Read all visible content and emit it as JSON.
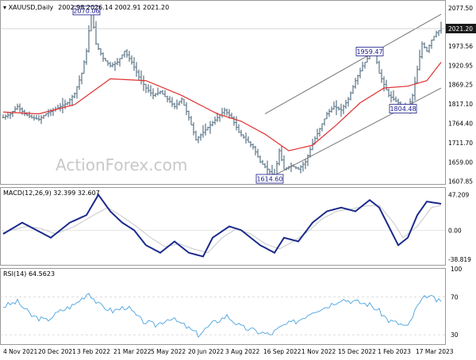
{
  "header": {
    "symbol": "XAUUSD,Daily",
    "ohlc": "2002.98 2026.14 2002.91 2021.20"
  },
  "watermark": "ActionForex.com",
  "colors": {
    "bar": "#5b7486",
    "ma": "#e03030",
    "channel": "#777777",
    "macd": "#1b2a8c",
    "signal": "#c8c8c8",
    "rsi": "#4aa3df",
    "price_badge": "#1a1a1a",
    "annotation_border": "#1a1a8c"
  },
  "chart_data": [
    {
      "type": "ohlc",
      "title": "XAUUSD,Daily",
      "ylim": [
        1600,
        2090
      ],
      "y_ticks": [
        "2077.50",
        "2021.20",
        "1973.56",
        "1920.95",
        "1869.25",
        "1817.10",
        "1764.40",
        "1711.70",
        "1659.00",
        "1607.85"
      ],
      "current_price": "2021.20",
      "x_ticks": [
        "4 Nov 2021",
        "20 Dec 2021",
        "3 Feb 2022",
        "21 Mar 2022",
        "5 May 2022",
        "20 Jun 2022",
        "3 Aug 2022",
        "16 Sep 2022",
        "1 Nov 2022",
        "15 Dec 2022",
        "1 Feb 2023",
        "17 Mar 2023"
      ],
      "price_path": [
        [
          0,
          1780
        ],
        [
          3,
          1790
        ],
        [
          6,
          1810
        ],
        [
          9,
          1790
        ],
        [
          12,
          1780
        ],
        [
          15,
          1775
        ],
        [
          18,
          1790
        ],
        [
          21,
          1800
        ],
        [
          24,
          1810
        ],
        [
          27,
          1820
        ],
        [
          30,
          1845
        ],
        [
          33,
          1900
        ],
        [
          35,
          1960
        ],
        [
          37,
          2070
        ],
        [
          39,
          1980
        ],
        [
          42,
          1940
        ],
        [
          45,
          1920
        ],
        [
          48,
          1930
        ],
        [
          51,
          1960
        ],
        [
          54,
          1930
        ],
        [
          57,
          1890
        ],
        [
          60,
          1860
        ],
        [
          63,
          1840
        ],
        [
          66,
          1850
        ],
        [
          69,
          1830
        ],
        [
          72,
          1810
        ],
        [
          75,
          1830
        ],
        [
          78,
          1780
        ],
        [
          81,
          1720
        ],
        [
          84,
          1740
        ],
        [
          87,
          1760
        ],
        [
          90,
          1780
        ],
        [
          93,
          1800
        ],
        [
          96,
          1780
        ],
        [
          99,
          1740
        ],
        [
          102,
          1720
        ],
        [
          105,
          1700
        ],
        [
          108,
          1660
        ],
        [
          111,
          1640
        ],
        [
          114,
          1620
        ],
        [
          116,
          1690
        ],
        [
          118,
          1640
        ],
        [
          121,
          1650
        ],
        [
          124,
          1640
        ],
        [
          127,
          1660
        ],
        [
          130,
          1710
        ],
        [
          133,
          1750
        ],
        [
          136,
          1790
        ],
        [
          139,
          1810
        ],
        [
          142,
          1800
        ],
        [
          145,
          1830
        ],
        [
          148,
          1880
        ],
        [
          151,
          1920
        ],
        [
          154,
          1950
        ],
        [
          156,
          1959
        ],
        [
          158,
          1900
        ],
        [
          160,
          1870
        ],
        [
          162,
          1840
        ],
        [
          164,
          1830
        ],
        [
          166,
          1820
        ],
        [
          168,
          1810
        ],
        [
          170,
          1804
        ],
        [
          172,
          1840
        ],
        [
          174,
          1910
        ],
        [
          176,
          1980
        ],
        [
          178,
          1960
        ],
        [
          180,
          1990
        ],
        [
          182,
          2010
        ],
        [
          184,
          2021
        ]
      ],
      "moving_average": [
        [
          0,
          1795
        ],
        [
          15,
          1790
        ],
        [
          30,
          1815
        ],
        [
          45,
          1885
        ],
        [
          60,
          1880
        ],
        [
          75,
          1840
        ],
        [
          90,
          1790
        ],
        [
          100,
          1770
        ],
        [
          110,
          1735
        ],
        [
          120,
          1690
        ],
        [
          130,
          1705
        ],
        [
          140,
          1760
        ],
        [
          150,
          1820
        ],
        [
          160,
          1860
        ],
        [
          170,
          1865
        ],
        [
          178,
          1880
        ],
        [
          184,
          1930
        ]
      ],
      "channel_lines": [
        [
          [
            110,
            1790
          ],
          [
            184,
            2060
          ]
        ],
        [
          [
            110,
            1610
          ],
          [
            184,
            1860
          ]
        ]
      ],
      "annotations": [
        {
          "label": "2070.06",
          "x": 37,
          "y": 2070
        },
        {
          "label": "1959.47",
          "x": 156,
          "y": 1959
        },
        {
          "label": "1804.48",
          "x": 170,
          "y": 1804
        },
        {
          "label": "1614.60",
          "x": 114,
          "y": 1614
        }
      ]
    },
    {
      "type": "line",
      "title": "MACD(12,26,9) 32.399 32.607",
      "ylim": [
        -45,
        55
      ],
      "y_ticks": [
        "47.209",
        "0.00",
        "-38.819"
      ],
      "series": [
        {
          "values": [
            [
              0,
              -5
            ],
            [
              8,
              10
            ],
            [
              14,
              0
            ],
            [
              20,
              -10
            ],
            [
              28,
              10
            ],
            [
              35,
              20
            ],
            [
              40,
              47
            ],
            [
              45,
              25
            ],
            [
              50,
              10
            ],
            [
              55,
              0
            ],
            [
              60,
              -20
            ],
            [
              66,
              -30
            ],
            [
              72,
              -15
            ],
            [
              78,
              -30
            ],
            [
              84,
              -35
            ],
            [
              88,
              -10
            ],
            [
              95,
              5
            ],
            [
              100,
              0
            ],
            [
              108,
              -20
            ],
            [
              114,
              -30
            ],
            [
              118,
              -10
            ],
            [
              124,
              -15
            ],
            [
              130,
              10
            ],
            [
              136,
              25
            ],
            [
              142,
              30
            ],
            [
              148,
              25
            ],
            [
              154,
              40
            ],
            [
              158,
              30
            ],
            [
              162,
              5
            ],
            [
              166,
              -20
            ],
            [
              170,
              -10
            ],
            [
              174,
              20
            ],
            [
              178,
              38
            ],
            [
              184,
              35
            ]
          ]
        },
        {
          "values": [
            [
              0,
              -3
            ],
            [
              10,
              5
            ],
            [
              16,
              2
            ],
            [
              22,
              -5
            ],
            [
              30,
              5
            ],
            [
              38,
              20
            ],
            [
              44,
              30
            ],
            [
              50,
              18
            ],
            [
              56,
              5
            ],
            [
              62,
              -10
            ],
            [
              68,
              -22
            ],
            [
              74,
              -18
            ],
            [
              80,
              -25
            ],
            [
              86,
              -30
            ],
            [
              92,
              -10
            ],
            [
              98,
              2
            ],
            [
              104,
              -5
            ],
            [
              110,
              -18
            ],
            [
              116,
              -25
            ],
            [
              122,
              -15
            ],
            [
              128,
              -2
            ],
            [
              134,
              15
            ],
            [
              140,
              25
            ],
            [
              146,
              28
            ],
            [
              152,
              32
            ],
            [
              158,
              33
            ],
            [
              164,
              10
            ],
            [
              168,
              -10
            ],
            [
              174,
              5
            ],
            [
              180,
              30
            ],
            [
              184,
              33
            ]
          ]
        }
      ]
    },
    {
      "type": "line",
      "title": "RSI(14) 64.5623",
      "ylim": [
        20,
        100
      ],
      "y_ticks": [
        "100",
        "70",
        "30"
      ],
      "series": [
        {
          "values": [
            [
              0,
              60
            ],
            [
              6,
              65
            ],
            [
              12,
              50
            ],
            [
              18,
              45
            ],
            [
              24,
              55
            ],
            [
              30,
              62
            ],
            [
              36,
              75
            ],
            [
              40,
              62
            ],
            [
              46,
              55
            ],
            [
              52,
              60
            ],
            [
              58,
              45
            ],
            [
              64,
              40
            ],
            [
              70,
              48
            ],
            [
              76,
              40
            ],
            [
              82,
              30
            ],
            [
              88,
              42
            ],
            [
              94,
              50
            ],
            [
              100,
              38
            ],
            [
              106,
              34
            ],
            [
              112,
              30
            ],
            [
              118,
              40
            ],
            [
              124,
              45
            ],
            [
              130,
              55
            ],
            [
              136,
              60
            ],
            [
              142,
              68
            ],
            [
              148,
              65
            ],
            [
              154,
              62
            ],
            [
              158,
              55
            ],
            [
              162,
              45
            ],
            [
              166,
              42
            ],
            [
              170,
              38
            ],
            [
              174,
              60
            ],
            [
              178,
              72
            ],
            [
              184,
              64
            ]
          ]
        }
      ]
    }
  ]
}
